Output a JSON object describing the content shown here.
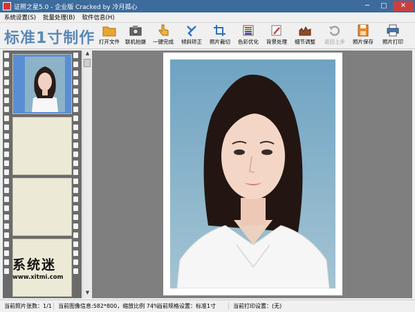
{
  "window": {
    "title": "证照之星5.0 - 企业版 Cracked by 冷月孤心",
    "minimize": "─",
    "maximize": "□",
    "close": "✕"
  },
  "menu": [
    {
      "label": "系统设置(S)"
    },
    {
      "label": "批量处理(B)"
    },
    {
      "label": "软件信息(H)"
    }
  ],
  "brand": "标准1寸制作",
  "toolbar": [
    {
      "label": "打开文件",
      "icon": "folder-icon",
      "enabled": true
    },
    {
      "label": "联机拍摄",
      "icon": "camera-icon",
      "enabled": true
    },
    {
      "label": "一键完成",
      "icon": "hand-pointer-icon",
      "enabled": true
    },
    {
      "label": "倾斜矫正",
      "icon": "rotate-icon",
      "enabled": true
    },
    {
      "label": "照片裁切",
      "icon": "crop-icon",
      "enabled": true
    },
    {
      "label": "色彩优化",
      "icon": "color-bars-icon",
      "enabled": true
    },
    {
      "label": "背景处理",
      "icon": "brush-icon",
      "enabled": true
    },
    {
      "label": "细节调整",
      "icon": "levels-icon",
      "enabled": true
    },
    {
      "label": "返回上步",
      "icon": "undo-icon",
      "enabled": false
    },
    {
      "label": "照片保存",
      "icon": "save-icon",
      "enabled": true
    },
    {
      "label": "照片打印",
      "icon": "printer-icon",
      "enabled": true
    }
  ],
  "watermark": {
    "cn": "系统迷",
    "url": "www.xitmi.com"
  },
  "status": {
    "count": "当前照片张数：1/1",
    "image_info": "当前图像信息:582*800，缩放比例 74%",
    "spec": "当前规格设置：标准1寸",
    "print": "当前打印设置：(无)"
  },
  "colors": {
    "titlebar": "#3c6b9c",
    "brand": "#5b88b8",
    "canvas": "#7f7f7f",
    "film": "#6b6b6b",
    "photo_bg": "#8bb2c7"
  }
}
